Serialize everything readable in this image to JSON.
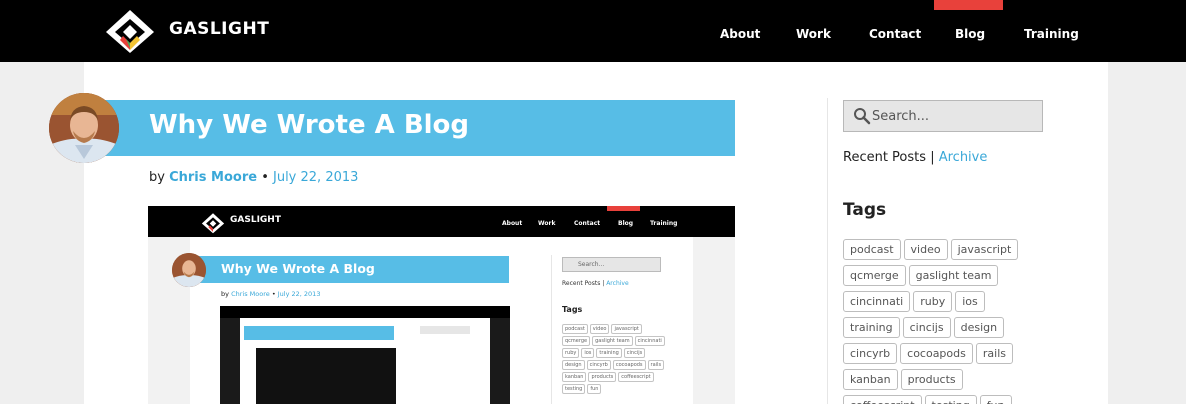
{
  "site": {
    "brand": "GASLIGHT"
  },
  "nav": {
    "items": [
      "About",
      "Work",
      "Contact",
      "Blog",
      "Training"
    ],
    "active": "Blog"
  },
  "post": {
    "title": "Why We Wrote A Blog",
    "by": "by",
    "author": "Chris Moore",
    "separator": "•",
    "date": "July 22, 2013"
  },
  "sidebar": {
    "search_placeholder": "Search...",
    "recent_posts": "Recent Posts",
    "pipe": "|",
    "archive": "Archive",
    "tags_heading": "Tags",
    "tags": [
      "podcast",
      "video",
      "javascript",
      "qcmerge",
      "gaslight team",
      "cincinnati",
      "ruby",
      "ios",
      "training",
      "cincijs",
      "design",
      "cincyrb",
      "cocoapods",
      "rails",
      "kanban",
      "products",
      "coffeescript",
      "testing",
      "fun"
    ]
  },
  "colors": {
    "accent_blue": "#57bde6",
    "link_blue": "#3aa8d8",
    "active_red": "#e8413b",
    "topbar": "#000000"
  },
  "icons": {
    "logo": "gaslight-diamond-logo",
    "search": "search-icon"
  }
}
